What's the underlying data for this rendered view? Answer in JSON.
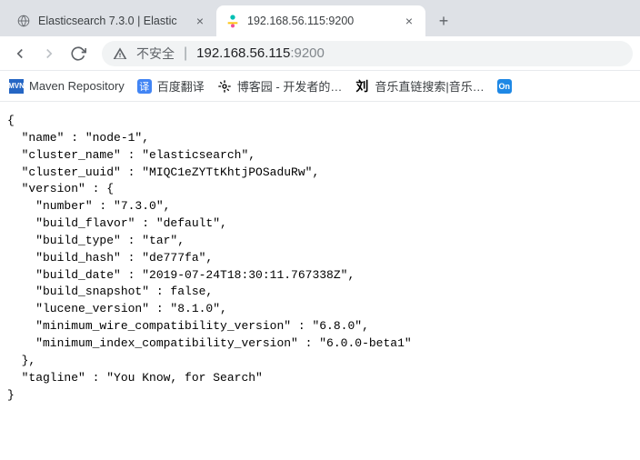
{
  "tabs": {
    "inactive_title": "Elasticsearch 7.3.0 | Elastic",
    "active_title": "192.168.56.115:9200"
  },
  "toolbar": {
    "insecure_label": "不安全",
    "url_host": "192.168.56.115",
    "url_port": ":9200"
  },
  "bookmarks": {
    "b1": "Maven Repository",
    "b2": "百度翻译",
    "b3": "博客园 - 开发者的…",
    "b4": "音乐直链搜索|音乐…",
    "icon1": "MVN",
    "icon2": "译",
    "icon4": "刘",
    "icon5": "On"
  },
  "json_body": "{\n  \"name\" : \"node-1\",\n  \"cluster_name\" : \"elasticsearch\",\n  \"cluster_uuid\" : \"MIQC1eZYTtKhtjPOSaduRw\",\n  \"version\" : {\n    \"number\" : \"7.3.0\",\n    \"build_flavor\" : \"default\",\n    \"build_type\" : \"tar\",\n    \"build_hash\" : \"de777fa\",\n    \"build_date\" : \"2019-07-24T18:30:11.767338Z\",\n    \"build_snapshot\" : false,\n    \"lucene_version\" : \"8.1.0\",\n    \"minimum_wire_compatibility_version\" : \"6.8.0\",\n    \"minimum_index_compatibility_version\" : \"6.0.0-beta1\"\n  },\n  \"tagline\" : \"You Know, for Search\"\n}"
}
